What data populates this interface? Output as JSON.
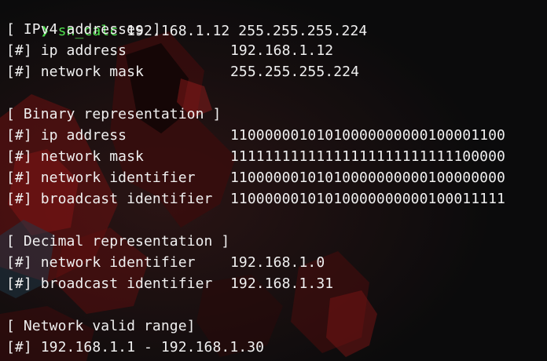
{
  "prompt": {
    "arrow": "❯",
    "command": "sn_calc",
    "args": " 192.168.1.12 255.255.255.224"
  },
  "ipv4": {
    "header": "[ IPv4 addresses ]",
    "rows": [
      {
        "label": "[#] ip address",
        "value": "192.168.1.12"
      },
      {
        "label": "[#] network mask",
        "value": "255.255.255.224"
      }
    ]
  },
  "binary": {
    "header": "[ Binary representation ]",
    "rows": [
      {
        "label": "[#] ip address",
        "value": "11000000101010000000000100001100"
      },
      {
        "label": "[#] network mask",
        "value": "11111111111111111111111111100000"
      },
      {
        "label": "[#] network identifier",
        "value": "11000000101010000000000100000000"
      },
      {
        "label": "[#] broadcast identifier",
        "value": "11000000101010000000000100011111"
      }
    ]
  },
  "decimal": {
    "header": "[ Decimal representation ]",
    "rows": [
      {
        "label": "[#] network identifier",
        "value": "192.168.1.0"
      },
      {
        "label": "[#] broadcast identifier",
        "value": "192.168.1.31"
      }
    ]
  },
  "range": {
    "header": "[ Network valid range]",
    "line": "[#] 192.168.1.1 - 192.168.1.30"
  },
  "colors": {
    "background": "#0b0b0c",
    "text": "#f0f0f0",
    "prompt": "#4ee04e",
    "wallpaper_red": "#7a1414"
  }
}
